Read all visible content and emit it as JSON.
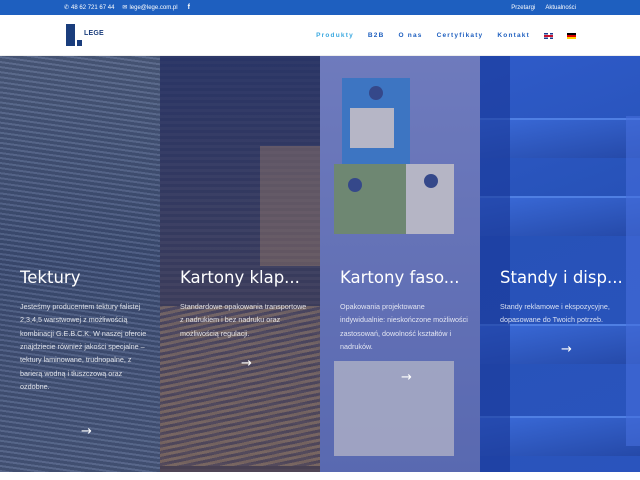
{
  "topbar": {
    "phone": "48 62 721 67 44",
    "email": "lege@lege.com.pl",
    "links": [
      "Przetargi",
      "Aktualności"
    ]
  },
  "header": {
    "logo_text": "LEGE",
    "nav": [
      {
        "label": "Produkty",
        "active": true
      },
      {
        "label": "B2B"
      },
      {
        "label": "O nas"
      },
      {
        "label": "Certyfikaty"
      },
      {
        "label": "Kontakt"
      }
    ],
    "languages": [
      "en-flag-icon",
      "de-flag-icon"
    ]
  },
  "panels": [
    {
      "title": "Tektury",
      "text": "Jesteśmy producentem tektury falistej 2,3,4,5 warstwowej z możliwością kombinacji G.E.B.C.K. W naszej ofercie znajdziecie również jakości specjalne – tektury laminowane, trudnopalne, z barierą wodną i tłuszczową oraz ozdobne.",
      "arrow": "→"
    },
    {
      "title": "Kartony klap...",
      "text": "Standardowe opakowania transportowe z nadrukiem i bez nadruku oraz możliwością regulacji.",
      "arrow": "→"
    },
    {
      "title": "Kartony faso...",
      "text": "Opakowania projektowane indywidualnie: nieskończone możliwości zastosowań, dowolność kształtów i nadruków.",
      "arrow": "→"
    },
    {
      "title": "Standy i disp...",
      "text": "Standy reklamowe i ekspozycyjne, dopasowane do Twoich potrzeb.",
      "arrow": "→"
    }
  ],
  "colors": {
    "topbar": "#1e5fbf",
    "nav": "#1e5fbf",
    "nav_active": "#39a8e0",
    "logo": "#1a3d7c"
  }
}
